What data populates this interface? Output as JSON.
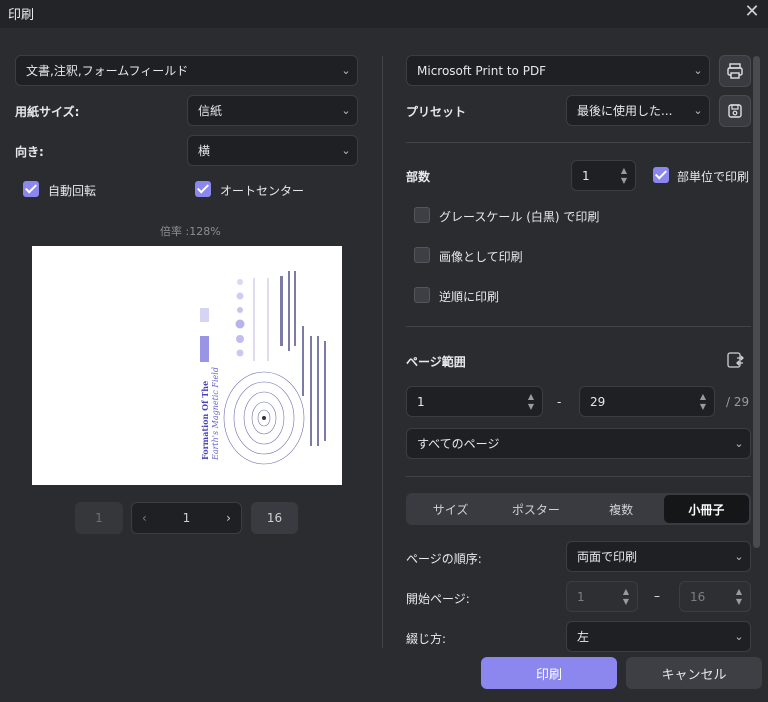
{
  "window": {
    "title": "印刷",
    "close_icon": "close-icon"
  },
  "left": {
    "content_select": "文書,注釈,フォームフィールド",
    "paper_size_label": "用紙サイズ:",
    "paper_size_value": "信紙",
    "orientation_label": "向き:",
    "orientation_value": "横",
    "auto_rotate_label": "自動回転",
    "auto_rotate_checked": true,
    "auto_center_label": "オートセンター",
    "auto_center_checked": true,
    "scale_text": "倍率 :128%",
    "preview_title_1": "Formation Of The",
    "preview_title_2": "Earth's Magnetic Field",
    "pager": {
      "first": "1",
      "current": "1",
      "last": "16"
    }
  },
  "right": {
    "printer": "Microsoft Print to PDF",
    "preset_label": "プリセット",
    "preset_value": "最後に使用した...",
    "copies_label": "部数",
    "copies_value": "1",
    "collate_label": "部単位で印刷",
    "collate_checked": true,
    "grayscale_label": "グレースケール (白黒) で印刷",
    "as_image_label": "画像として印刷",
    "reverse_label": "逆順に印刷",
    "page_range_label": "ページ範囲",
    "range_from": "1",
    "range_dash": "-",
    "range_to": "29",
    "range_total": "/ 29",
    "page_subset": "すべてのページ",
    "tabs": [
      "サイズ",
      "ポスター",
      "複数",
      "小冊子"
    ],
    "active_tab": "小冊子",
    "page_order_label": "ページの順序:",
    "page_order_value": "両面で印刷",
    "start_page_label": "開始ページ:",
    "start_page_from": "1",
    "start_page_dash": "–",
    "start_page_to": "16",
    "binding_label": "綴じ方:",
    "binding_value": "左"
  },
  "actions": {
    "print": "印刷",
    "cancel": "キャンセル"
  },
  "colors": {
    "accent": "#8c87ee",
    "background": "#2b2c30",
    "input": "#1f2023"
  }
}
